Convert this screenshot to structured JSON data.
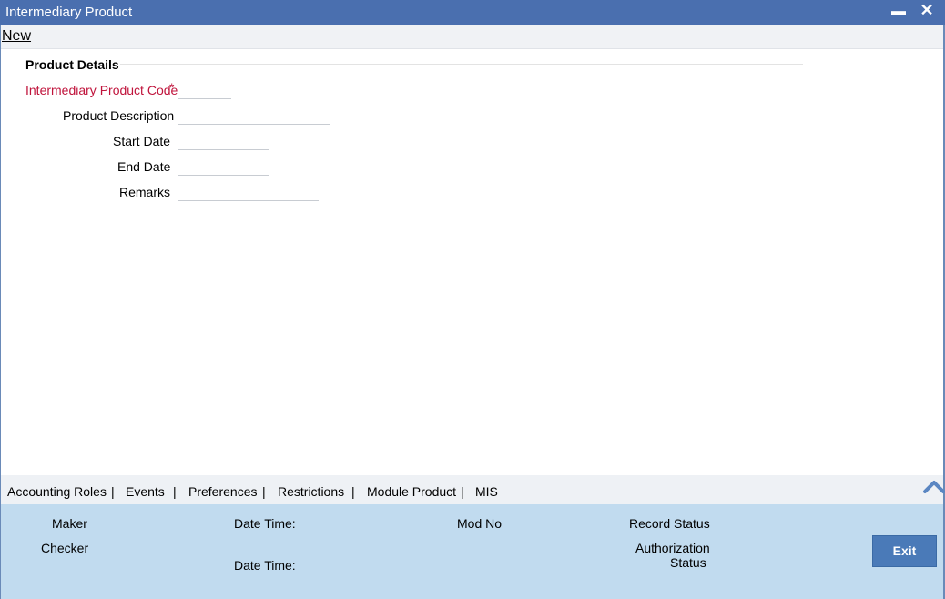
{
  "window": {
    "title": "Intermediary Product",
    "minimize_glyph": "▬",
    "close_glyph": "✕"
  },
  "toolbar": {
    "new_label": "New"
  },
  "section": {
    "title": "Product Details"
  },
  "fields": {
    "product_code": {
      "label": "Intermediary Product Code",
      "required_mark": "*",
      "value": ""
    },
    "description": {
      "label": "Product Description",
      "value": ""
    },
    "start_date": {
      "label": "Start Date",
      "value": ""
    },
    "end_date": {
      "label": "End Date",
      "value": ""
    },
    "remarks": {
      "label": "Remarks",
      "value": ""
    }
  },
  "tabs": {
    "items": [
      "Accounting Roles",
      "Events",
      "Preferences",
      "Restrictions",
      "Module Product",
      "MIS"
    ],
    "separator": "|"
  },
  "footer": {
    "maker": "Maker",
    "checker": "Checker",
    "date_time_1": "Date Time:",
    "date_time_2": "Date Time:",
    "mod_no": "Mod No",
    "record_status": "Record Status",
    "authorization": "Authorization",
    "status": "Status",
    "exit_label": "Exit"
  },
  "colors": {
    "title_bar": "#4a6faf",
    "required_label": "#c0143c",
    "footer_bg": "#c1dbef",
    "exit_button": "#4a7ab8"
  },
  "icons": {
    "collapse": "chevron-up-icon"
  }
}
